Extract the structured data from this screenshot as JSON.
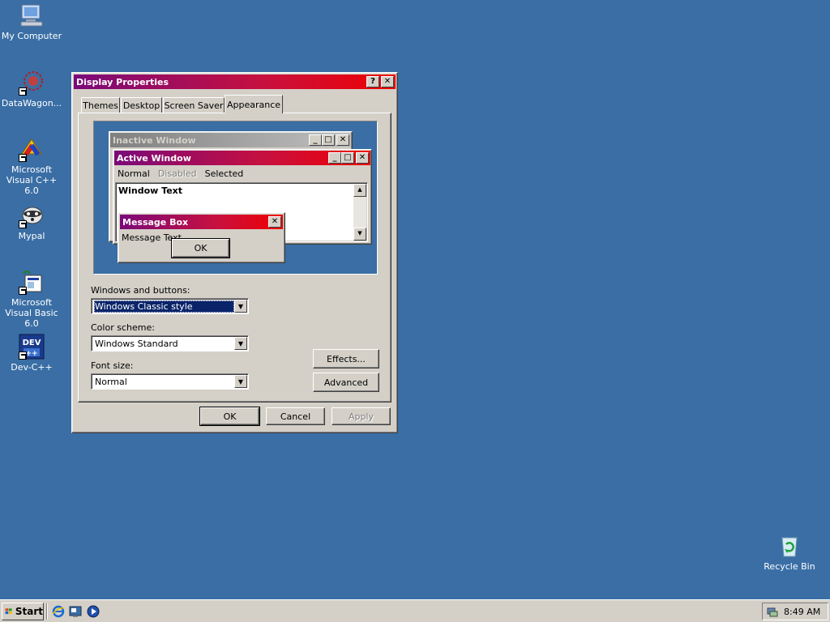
{
  "desktop": {
    "icons": [
      {
        "label": "My Computer"
      },
      {
        "label": "DataWagon..."
      },
      {
        "label": "Microsoft Visual C++ 6.0"
      },
      {
        "label": "Mypal"
      },
      {
        "label": "Microsoft Visual Basic 6.0"
      },
      {
        "label": "Dev-C++"
      },
      {
        "label": "Recycle Bin"
      }
    ]
  },
  "dialog": {
    "title": "Display Properties",
    "help_button": "?",
    "close_button": "✕",
    "tabs": [
      {
        "label": "Themes"
      },
      {
        "label": "Desktop"
      },
      {
        "label": "Screen Saver"
      },
      {
        "label": "Appearance"
      }
    ],
    "active_tab": "Appearance",
    "preview": {
      "inactive_title": "Inactive Window",
      "active_title": "Active Window",
      "menu_normal": "Normal",
      "menu_disabled": "Disabled",
      "menu_selected": "Selected",
      "window_text": "Window Text",
      "msgbox_title": "Message Box",
      "msgbox_text": "Message Text",
      "msgbox_ok": "OK"
    },
    "windows_buttons_label": "Windows and buttons:",
    "windows_buttons_value": "Windows Classic style",
    "color_scheme_label": "Color scheme:",
    "color_scheme_value": "Windows Standard",
    "font_size_label": "Font size:",
    "font_size_value": "Normal",
    "effects_button": "Effects...",
    "advanced_button": "Advanced",
    "ok_button": "OK",
    "cancel_button": "Cancel",
    "apply_button": "Apply"
  },
  "taskbar": {
    "start_label": "Start",
    "clock": "8:49 AM"
  },
  "colors": {
    "desktop": "#3a6ea5",
    "face": "#d4d0c8",
    "title_active_start": "#7a0a7a",
    "title_active_end": "#f00000",
    "selection": "#0a246a"
  }
}
